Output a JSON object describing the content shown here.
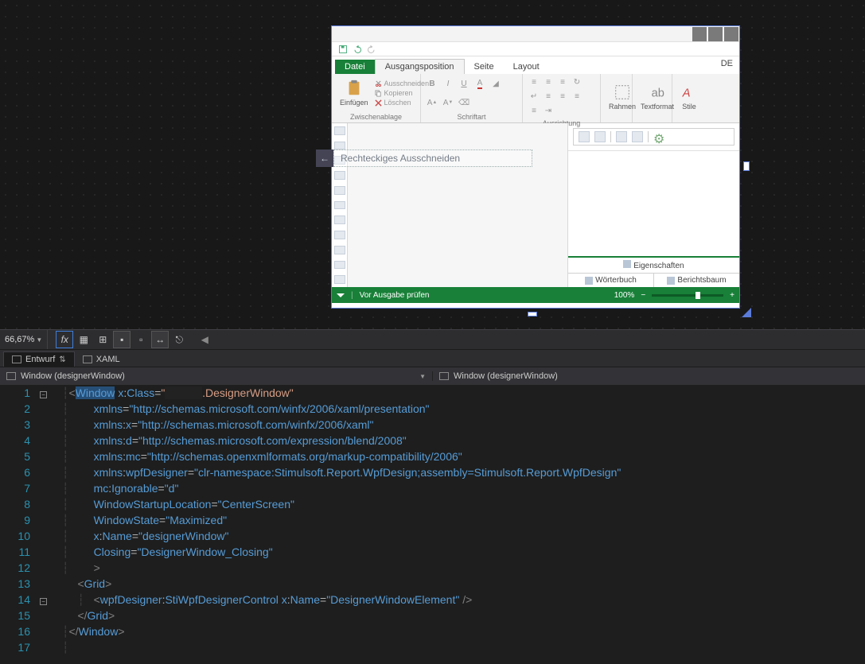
{
  "designer": {
    "tabs": {
      "file": "Datei",
      "home": "Ausgangsposition",
      "page": "Seite",
      "layout": "Layout"
    },
    "lang_indicator": "DE",
    "clipboard": {
      "paste": "Einfügen",
      "cut": "Ausschneiden",
      "copy": "Kopieren",
      "delete": "Löschen",
      "group_label": "Zwischenablage"
    },
    "font_group_label": "Schriftart",
    "alignment_group_label": "Ausrichtung",
    "frame_label": "Rahmen",
    "textformat_label": "Textformat",
    "styles_label": "Stile",
    "right_panel": {
      "properties": "Eigenschaften",
      "dictionary": "Wörterbuch",
      "report_tree": "Berichtsbaum"
    },
    "status": {
      "check_before_output": "Vor Ausgabe prüfen",
      "zoom": "100%",
      "minus": "−",
      "plus": "+"
    }
  },
  "snip_tool": {
    "back_arrow": "←",
    "label": "Rechteckiges Ausschneiden"
  },
  "vs": {
    "zoom": "66,67%",
    "design_tab": "Entwurf",
    "xaml_tab": "XAML",
    "breadcrumb_left": "Window (designerWindow)",
    "breadcrumb_right": "Window (designerWindow)"
  },
  "code": {
    "class_masked": "            ",
    "class_suffix": ".DesignerWindow",
    "xmlns_presentation": "http://schemas.microsoft.com/winfx/2006/xaml/presentation",
    "xmlns_x": "http://schemas.microsoft.com/winfx/2006/xaml",
    "xmlns_d": "http://schemas.microsoft.com/expression/blend/2008",
    "xmlns_mc": "http://schemas.openxmlformats.org/markup-compatibility/2006",
    "xmlns_wpfDesigner": "clr-namespace:Stimulsoft.Report.WpfDesign;assembly=Stimulsoft.Report.WpfDesign",
    "ignorable": "d",
    "startup_loc": "CenterScreen",
    "window_state": "Maximized",
    "x_name": "designerWindow",
    "closing": "DesignerWindow_Closing",
    "control_name": "DesignerWindowElement"
  },
  "line_numbers": [
    "1",
    "2",
    "3",
    "4",
    "5",
    "6",
    "7",
    "8",
    "9",
    "10",
    "11",
    "12",
    "13",
    "14",
    "15",
    "16",
    "17"
  ]
}
